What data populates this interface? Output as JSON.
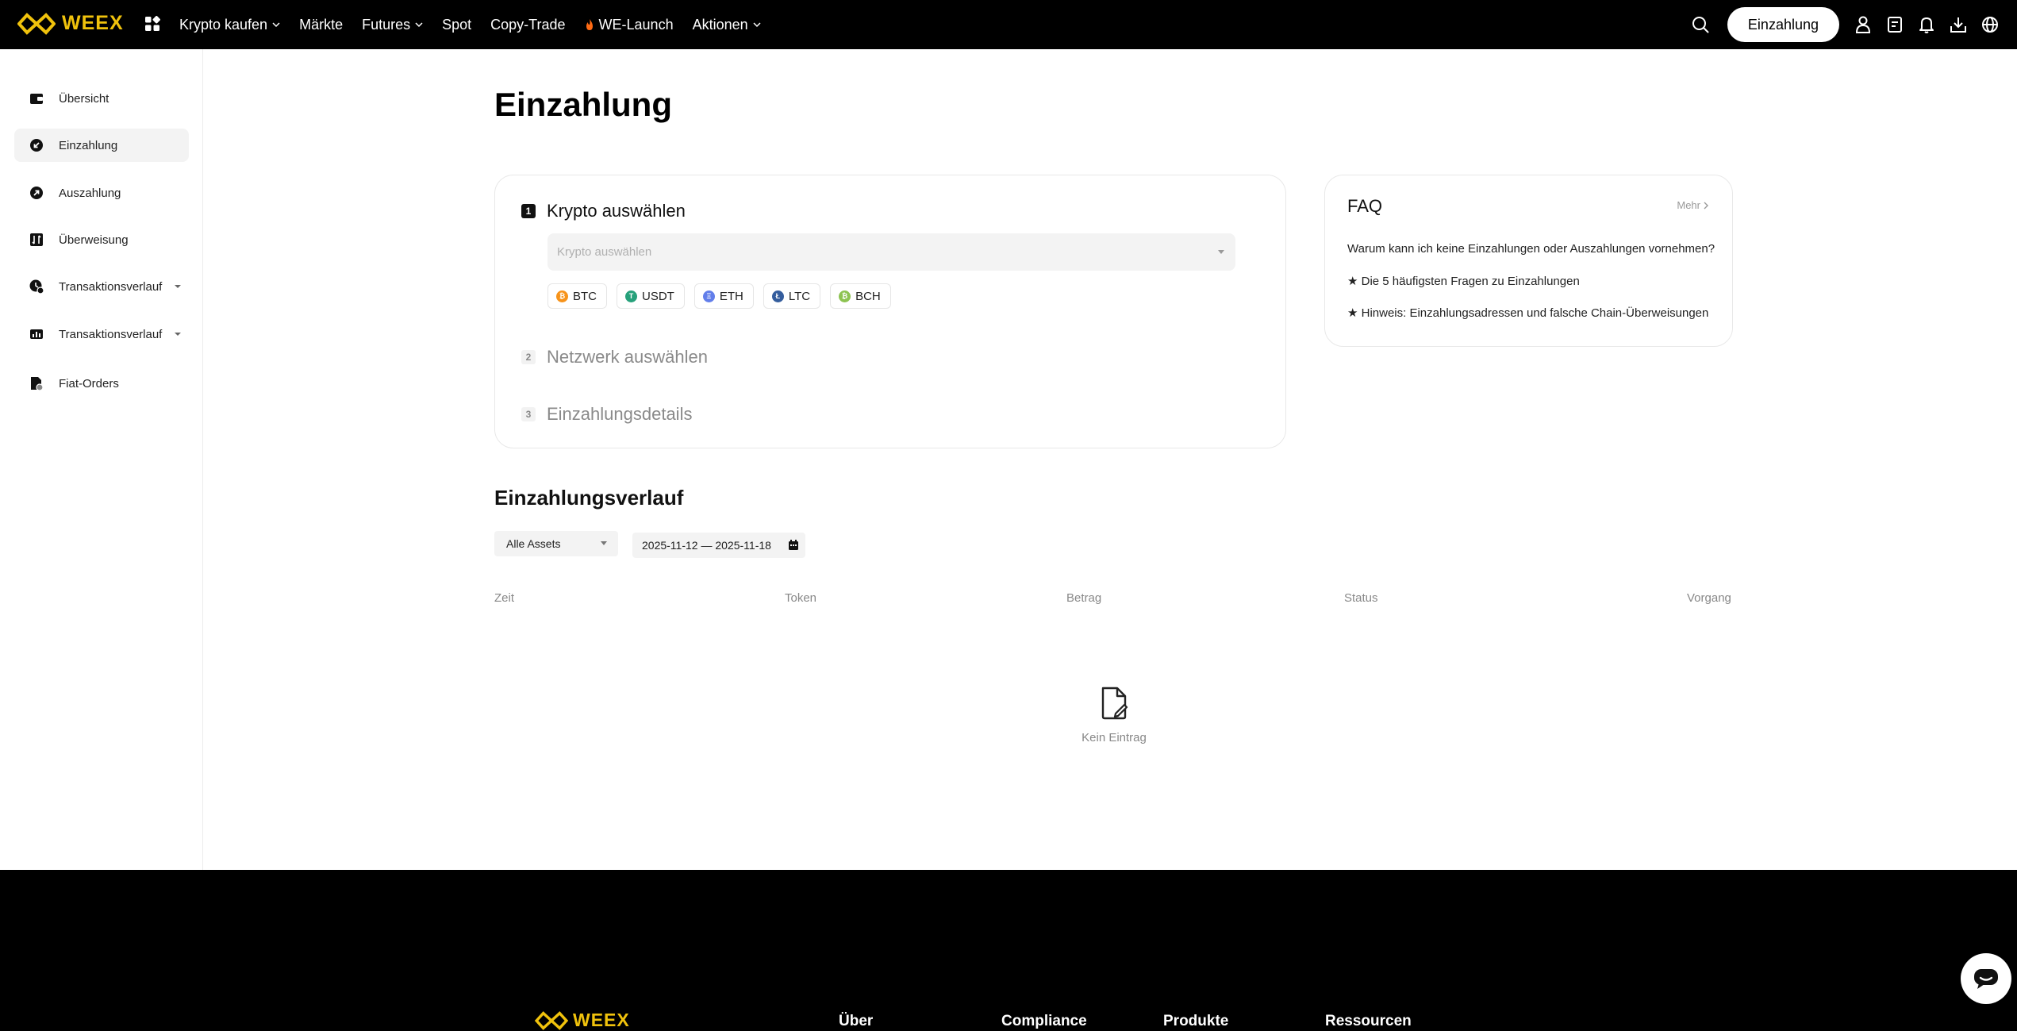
{
  "brand": {
    "name": "WEEX",
    "color": "#f0c20c"
  },
  "nav": {
    "items": [
      {
        "label": "Krypto kaufen",
        "has_dropdown": true
      },
      {
        "label": "Märkte",
        "has_dropdown": false
      },
      {
        "label": "Futures",
        "has_dropdown": true
      },
      {
        "label": "Spot",
        "has_dropdown": false
      },
      {
        "label": "Copy-Trade",
        "has_dropdown": false
      },
      {
        "label": "WE-Launch",
        "has_dropdown": false,
        "icon": "fire-icon"
      },
      {
        "label": "Aktionen",
        "has_dropdown": true
      }
    ],
    "deposit_button": "Einzahlung",
    "right_icons": [
      "search-icon",
      "user-icon",
      "orders-icon",
      "bell-icon",
      "download-icon",
      "globe-icon"
    ]
  },
  "sidebar": {
    "items": [
      {
        "label": "Übersicht",
        "icon": "wallet-icon",
        "active": false,
        "has_dropdown": false
      },
      {
        "label": "Einzahlung",
        "icon": "deposit-icon",
        "active": true,
        "has_dropdown": false
      },
      {
        "label": "Auszahlung",
        "icon": "withdraw-icon",
        "active": false,
        "has_dropdown": false
      },
      {
        "label": "Überweisung",
        "icon": "transfer-icon",
        "active": false,
        "has_dropdown": false
      },
      {
        "label": "Transaktionsverlauf",
        "icon": "history-icon",
        "active": false,
        "has_dropdown": true
      },
      {
        "label": "Transaktionsverlauf",
        "icon": "chart-history-icon",
        "active": false,
        "has_dropdown": true
      },
      {
        "label": "Fiat-Orders",
        "icon": "fiat-orders-icon",
        "active": false,
        "has_dropdown": false
      }
    ]
  },
  "main": {
    "title": "Einzahlung",
    "steps": [
      {
        "number": "1",
        "label": "Krypto auswählen",
        "active": true
      },
      {
        "number": "2",
        "label": "Netzwerk auswählen",
        "active": false
      },
      {
        "number": "3",
        "label": "Einzahlungsdetails",
        "active": false
      }
    ],
    "crypto_select_placeholder": "Krypto auswählen",
    "coins": [
      {
        "symbol": "BTC",
        "icon": "btc-icon",
        "color": "#f7931a",
        "glyph": "₿"
      },
      {
        "symbol": "USDT",
        "icon": "usdt-icon",
        "color": "#26a17b",
        "glyph": "T"
      },
      {
        "symbol": "ETH",
        "icon": "eth-icon",
        "color": "#627eea",
        "glyph": "Ξ"
      },
      {
        "symbol": "LTC",
        "icon": "ltc-icon",
        "color": "#345d9d",
        "glyph": "Ł"
      },
      {
        "symbol": "BCH",
        "icon": "bch-icon",
        "color": "#8dc351",
        "glyph": "₿"
      }
    ]
  },
  "faq": {
    "title": "FAQ",
    "more": "Mehr",
    "questions": [
      "Warum kann ich keine Einzahlungen oder Auszahlungen vornehmen?",
      "★ Die 5 häufigsten Fragen zu Einzahlungen",
      "★ Hinweis: Einzahlungsadressen und falsche Chain-Überweisungen"
    ]
  },
  "history": {
    "title": "Einzahlungsverlauf",
    "asset_filter": "Alle Assets",
    "date_range": "2025-11-12 — 2025-11-18",
    "columns": [
      "Zeit",
      "Token",
      "Betrag",
      "Status",
      "Vorgang"
    ],
    "empty_text": "Kein Eintrag"
  },
  "footer": {
    "columns": [
      "Über",
      "Compliance",
      "Produkte",
      "Ressourcen"
    ]
  }
}
